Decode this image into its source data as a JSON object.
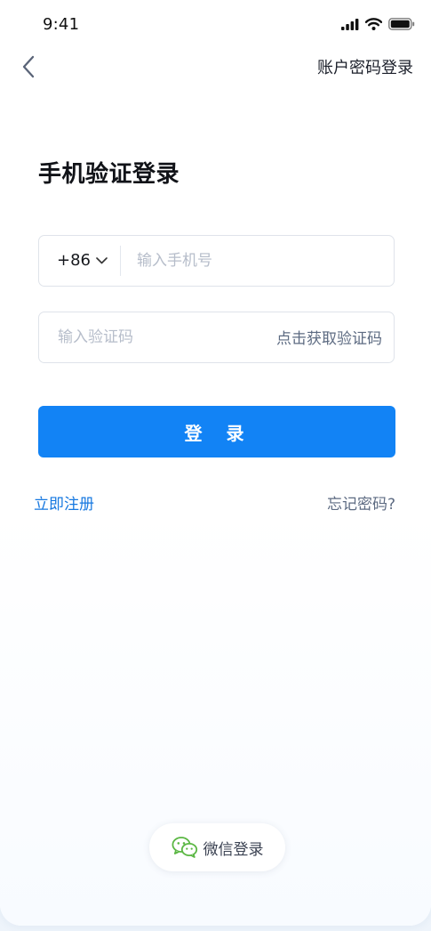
{
  "status_bar": {
    "time": "9:41"
  },
  "nav": {
    "right_link": "账户密码登录"
  },
  "page": {
    "title": "手机验证登录"
  },
  "phone_field": {
    "country_code": "+86",
    "placeholder": "输入手机号",
    "value": ""
  },
  "code_field": {
    "placeholder": "输入验证码",
    "value": "",
    "get_code_label": "点击获取验证码"
  },
  "actions": {
    "login_label": "登 录",
    "register_label": "立即注册",
    "forgot_label": "忘记密码?"
  },
  "social": {
    "wechat_label": "微信登录"
  },
  "colors": {
    "primary": "#1283f5",
    "link_blue": "#1678e0",
    "secondary_text": "#5d6b82",
    "wechat_green": "#5bb744"
  },
  "icons": {
    "back": "chevron-left-icon",
    "dropdown": "chevron-down-icon",
    "wechat": "wechat-icon",
    "signal": "signal-icon",
    "wifi": "wifi-icon",
    "battery": "battery-icon"
  }
}
